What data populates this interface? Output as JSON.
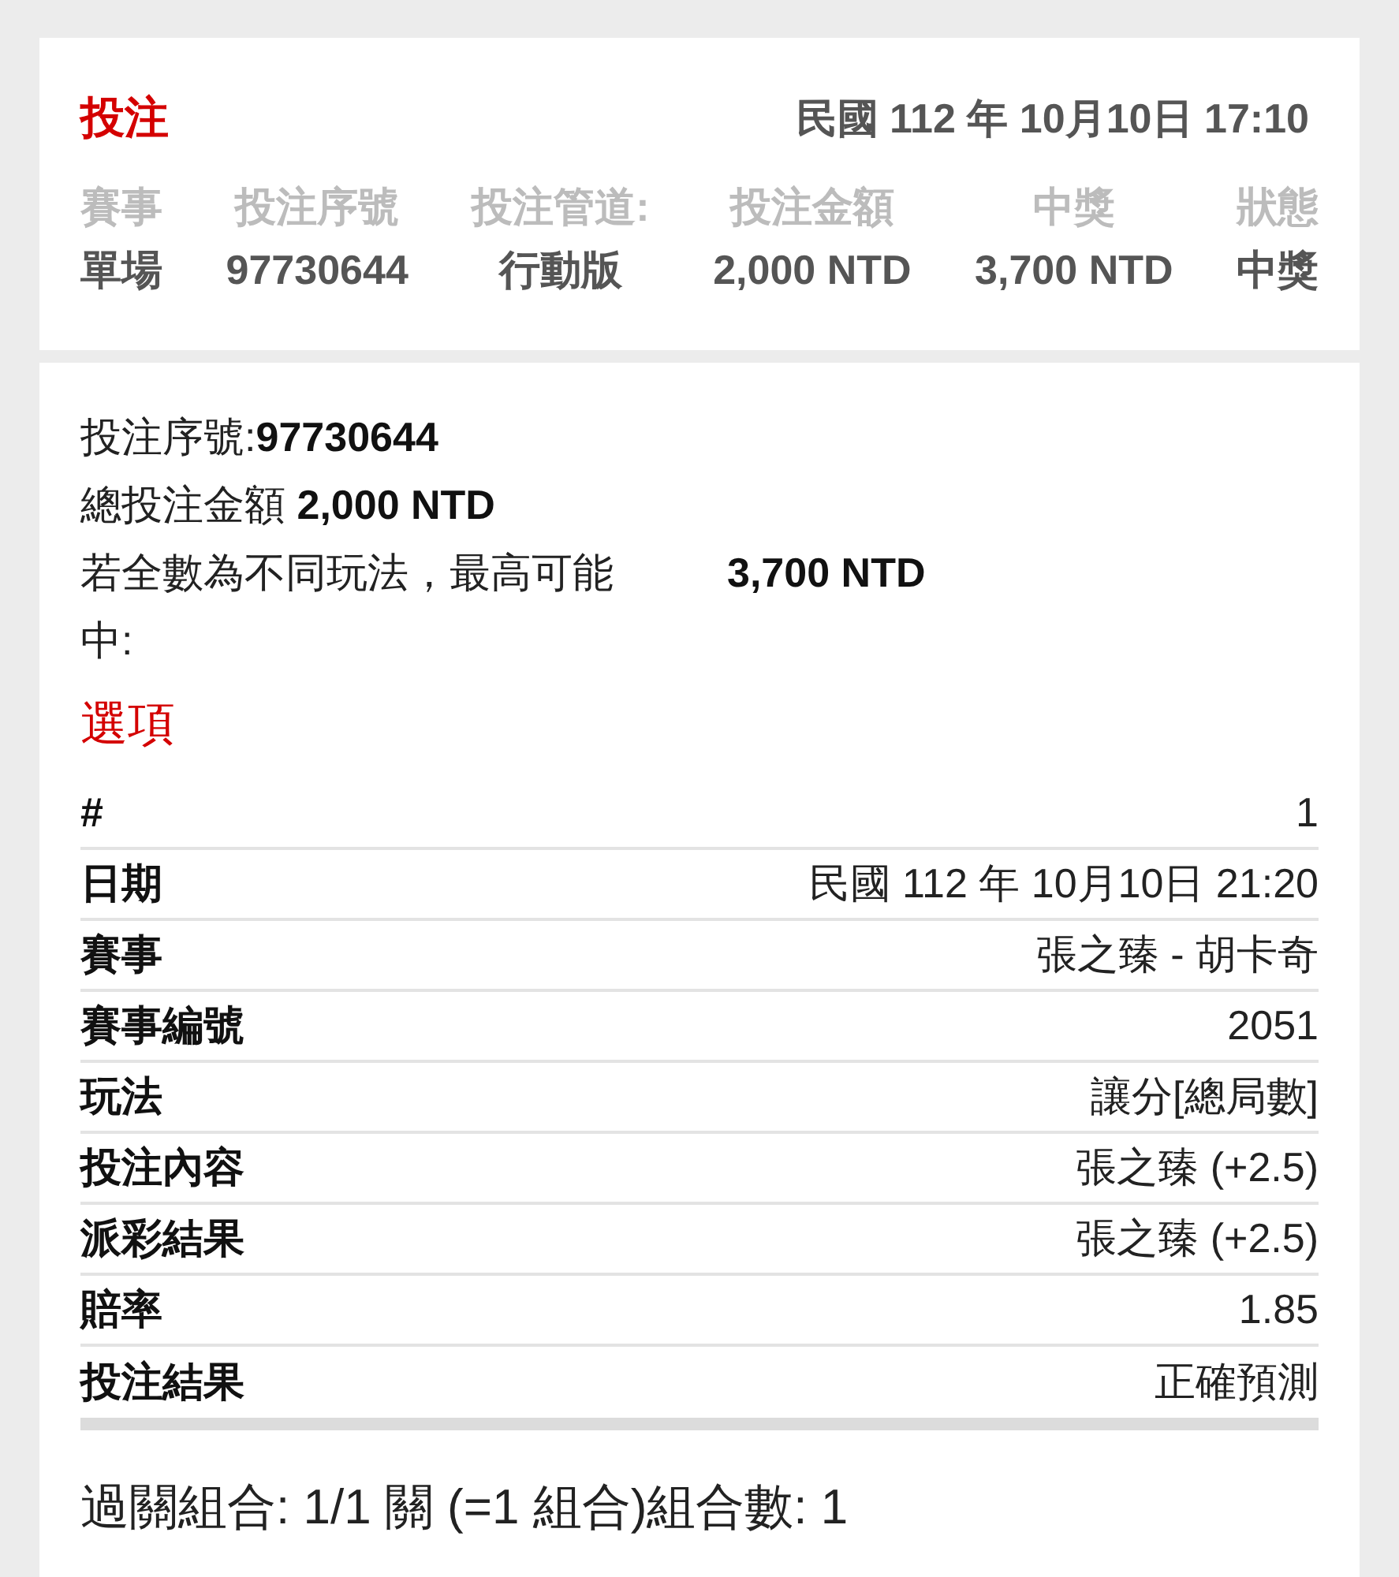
{
  "header": {
    "title": "投注",
    "timestamp": "民國 112 年 10月10日 17:10"
  },
  "summary": [
    {
      "heading": "賽事",
      "value": "單場"
    },
    {
      "heading": "投注序號",
      "value": "97730644"
    },
    {
      "heading": "投注管道:",
      "value": "行動版"
    },
    {
      "heading": "投注金額",
      "value": "2,000 NTD"
    },
    {
      "heading": "中獎",
      "value": "3,700 NTD"
    },
    {
      "heading": "狀態",
      "value": "中獎"
    }
  ],
  "details": {
    "bet_number": {
      "label": "投注序號:",
      "value": "97730644"
    },
    "total": {
      "label": "總投注金額",
      "value": "2,000 NTD"
    },
    "max_win": {
      "label": "若全數為不同玩法，最高可能中:",
      "value": "3,700 NTD"
    },
    "options_heading": "選項",
    "rows": [
      {
        "label": "#",
        "value": "1"
      },
      {
        "label": "日期",
        "value": "民國 112 年 10月10日 21:20"
      },
      {
        "label": "賽事",
        "value": "張之臻 - 胡卡奇"
      },
      {
        "label": "賽事編號",
        "value": "2051"
      },
      {
        "label": "玩法",
        "value": "讓分[總局數]"
      },
      {
        "label": "投注內容",
        "value": "張之臻 (+2.5)"
      },
      {
        "label": "派彩結果",
        "value": "張之臻 (+2.5)"
      },
      {
        "label": "賠率",
        "value": "1.85"
      },
      {
        "label": "投注結果",
        "value": "正確預測"
      }
    ],
    "combination": "過關組合: 1/1 關 (=1 組合)組合數: 1"
  }
}
